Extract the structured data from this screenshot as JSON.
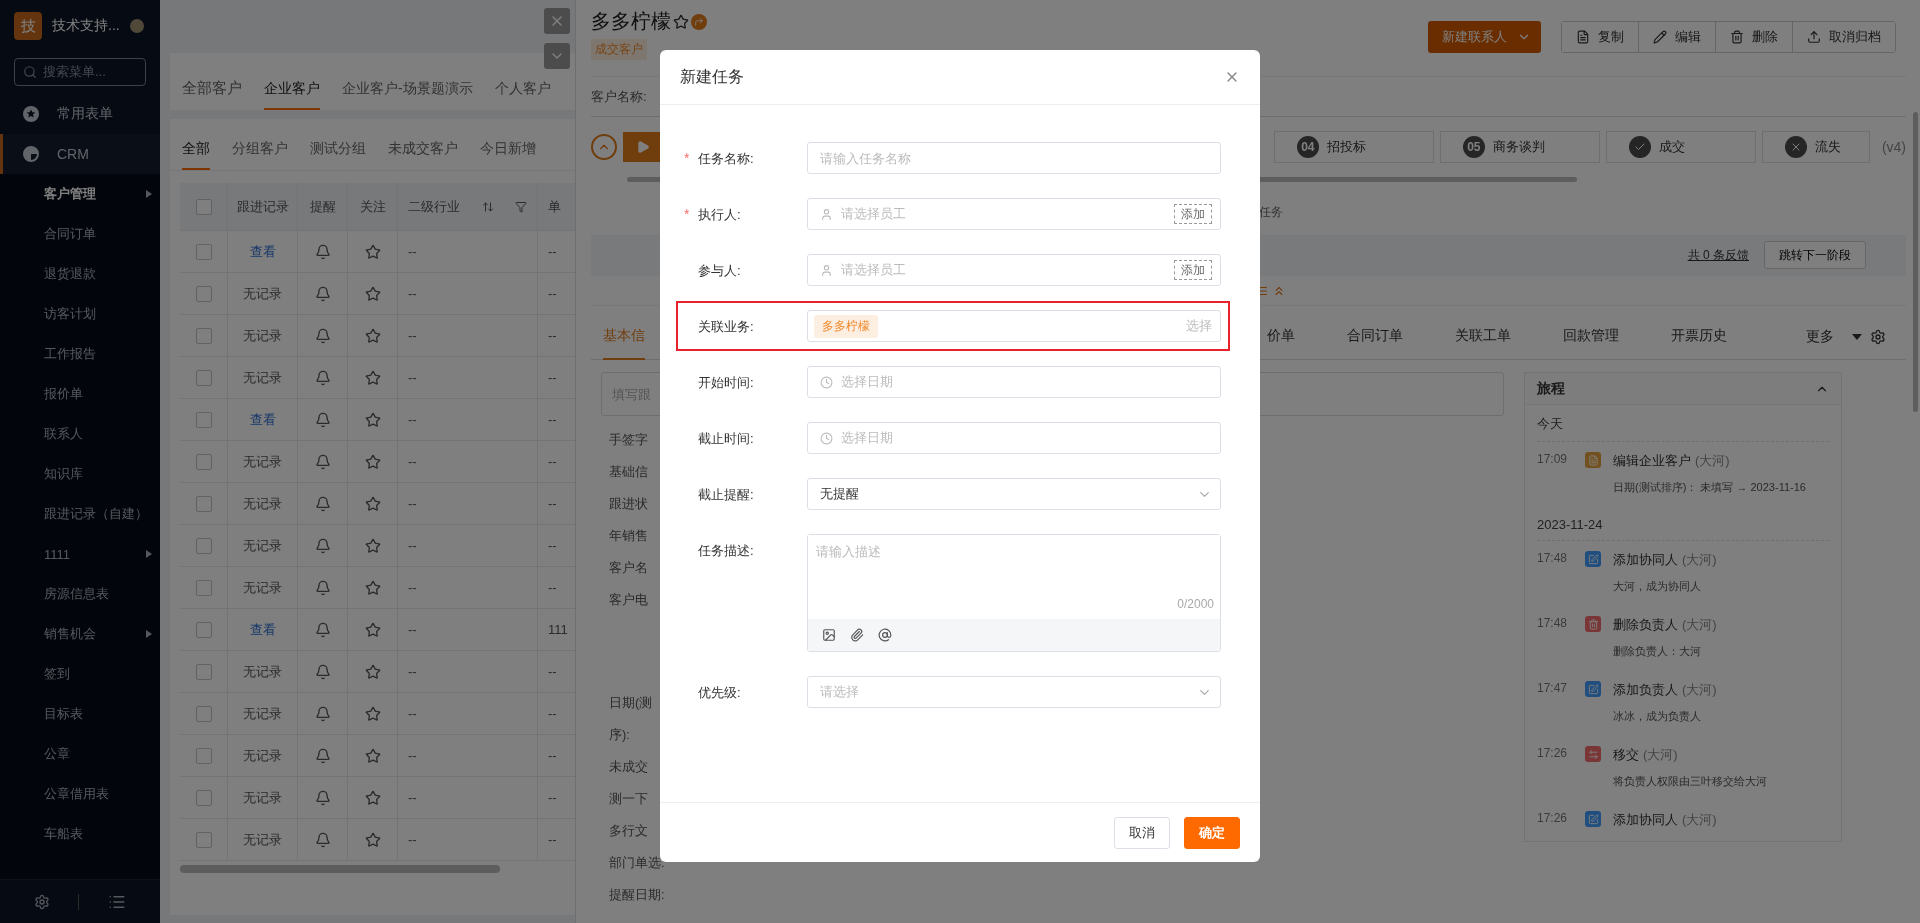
{
  "sidebar": {
    "logo": "技",
    "title": "技术支持...",
    "search_placeholder": "搜索菜单...",
    "sections": [
      {
        "label": "常用表单",
        "kind": "star",
        "selected": false
      },
      {
        "label": "CRM",
        "kind": "chart",
        "selected": true
      }
    ],
    "menu": [
      {
        "label": "客户管理",
        "selected": true,
        "submenu": true
      },
      {
        "label": "合同订单",
        "selected": false,
        "submenu": false
      },
      {
        "label": "退货退款",
        "selected": false,
        "submenu": false
      },
      {
        "label": "访客计划",
        "selected": false,
        "submenu": false
      },
      {
        "label": "工作报告",
        "selected": false,
        "submenu": false
      },
      {
        "label": "报价单",
        "selected": false,
        "submenu": false
      },
      {
        "label": "联系人",
        "selected": false,
        "submenu": false
      },
      {
        "label": "知识库",
        "selected": false,
        "submenu": false
      },
      {
        "label": "跟进记录（自建）",
        "selected": false,
        "submenu": false
      },
      {
        "label": "1111",
        "selected": false,
        "submenu": true
      },
      {
        "label": "房源信息表",
        "selected": false,
        "submenu": false
      },
      {
        "label": "销售机会",
        "selected": false,
        "submenu": true
      },
      {
        "label": "签到",
        "selected": false,
        "submenu": false
      },
      {
        "label": "目标表",
        "selected": false,
        "submenu": false
      },
      {
        "label": "公章",
        "selected": false,
        "submenu": false
      },
      {
        "label": "公章借用表",
        "selected": false,
        "submenu": false
      },
      {
        "label": "车船表",
        "selected": false,
        "submenu": false
      }
    ]
  },
  "customer_tabs": [
    {
      "label": "全部客户",
      "selected": false
    },
    {
      "label": "企业客户",
      "selected": true
    },
    {
      "label": "企业客户-场景题演示",
      "selected": false
    },
    {
      "label": "个人客户",
      "selected": false
    }
  ],
  "group_tabs": [
    {
      "label": "全部",
      "selected": true
    },
    {
      "label": "分组客户",
      "selected": false
    },
    {
      "label": "测试分组",
      "selected": false
    },
    {
      "label": "未成交客户",
      "selected": false
    },
    {
      "label": "今日新增",
      "selected": false
    }
  ],
  "table": {
    "all_checked": false,
    "columns": [
      "跟进记录",
      "提醒",
      "关注",
      "二级行业",
      "单"
    ],
    "rows": [
      {
        "checked": false,
        "record": "查看",
        "kind": "link",
        "followed": false,
        "industry": "--",
        "column_5": "--"
      },
      {
        "checked": false,
        "record": "无记录",
        "kind": "text",
        "followed": false,
        "industry": "--",
        "column_5": "--"
      },
      {
        "checked": false,
        "record": "无记录",
        "kind": "text",
        "followed": false,
        "industry": "--",
        "column_5": "--"
      },
      {
        "checked": false,
        "record": "无记录",
        "kind": "text",
        "followed": false,
        "industry": "--",
        "column_5": "--"
      },
      {
        "checked": false,
        "record": "查看",
        "kind": "link",
        "followed": false,
        "industry": "--",
        "column_5": "--"
      },
      {
        "checked": false,
        "record": "无记录",
        "kind": "text",
        "followed": false,
        "industry": "--",
        "column_5": "--"
      },
      {
        "checked": false,
        "record": "无记录",
        "kind": "text",
        "followed": false,
        "industry": "--",
        "column_5": "--"
      },
      {
        "checked": false,
        "record": "无记录",
        "kind": "text",
        "followed": false,
        "industry": "--",
        "column_5": "--"
      },
      {
        "checked": false,
        "record": "无记录",
        "kind": "text",
        "followed": false,
        "industry": "--",
        "column_5": "--"
      },
      {
        "checked": false,
        "record": "查看",
        "kind": "link",
        "followed": false,
        "industry": "--",
        "column_5": "111"
      },
      {
        "checked": false,
        "record": "无记录",
        "kind": "text",
        "followed": false,
        "industry": "--",
        "column_5": "--"
      },
      {
        "checked": false,
        "record": "无记录",
        "kind": "text",
        "followed": false,
        "industry": "--",
        "column_5": "--"
      },
      {
        "checked": false,
        "record": "无记录",
        "kind": "text",
        "followed": false,
        "industry": "--",
        "column_5": "--"
      },
      {
        "checked": false,
        "record": "无记录",
        "kind": "text",
        "followed": false,
        "industry": "--",
        "column_5": "--"
      },
      {
        "checked": false,
        "record": "无记录",
        "kind": "text",
        "followed": false,
        "industry": "--",
        "column_5": "--"
      }
    ]
  },
  "detail": {
    "title": "多多柠檬",
    "status_tag": "成交客户",
    "followed": false,
    "customer_name_label": "客户名称:",
    "primary_button": "新建联系人",
    "actions": [
      {
        "label": "复制",
        "kind": "copy"
      },
      {
        "label": "编辑",
        "kind": "edit"
      },
      {
        "label": "删除",
        "kind": "delete"
      },
      {
        "label": "取消归档",
        "kind": "unarchive"
      }
    ],
    "stages": [
      {
        "number": "04",
        "label": "招投标",
        "kind": "step"
      },
      {
        "number": "05",
        "label": "商务谈判",
        "kind": "step"
      },
      {
        "label": "成交",
        "kind": "won"
      },
      {
        "label": "流失",
        "kind": "lost"
      }
    ],
    "version": "(v4)",
    "task_note": "任务",
    "feedback_link": "共 0 条反馈",
    "next_stage_button": "跳转下一阶段",
    "tabs": [
      {
        "label": "基本信",
        "selected": true
      },
      {
        "label": "价单",
        "selected": false
      },
      {
        "label": "合同订单",
        "selected": false
      },
      {
        "label": "关联工单",
        "selected": false
      },
      {
        "label": "回款管理",
        "selected": false
      },
      {
        "label": "开票历史",
        "selected": false
      }
    ],
    "more": "更多",
    "follow_placeholder": "填写跟",
    "field_labels": [
      "手签字",
      "基础信",
      "跟进状",
      "年销售",
      "客户名",
      "客户电",
      "日期(测",
      "序):",
      "未成交",
      "测一下",
      "多行文",
      "部门单选:",
      "提醒日期:"
    ],
    "timeline": {
      "title": "旅程",
      "groups": [
        {
          "date": "今天",
          "events": [
            {
              "time": "17:09",
              "title": "编辑企业客户",
              "actor": "(大河)",
              "detail": "日期(测试排序)： 未填写 → 2023-11-16",
              "kind": "update"
            }
          ]
        },
        {
          "date": "2023-11-24",
          "events": [
            {
              "time": "17:48",
              "title": "添加协同人",
              "actor": "(大河)",
              "detail": "大河，成为协同人",
              "kind": "add"
            },
            {
              "time": "17:48",
              "title": "删除负责人",
              "actor": "(大河)",
              "detail": "删除负责人：大河",
              "kind": "remove"
            },
            {
              "time": "17:47",
              "title": "添加负责人",
              "actor": "(大河)",
              "detail": "冰冰，成为负责人",
              "kind": "add"
            },
            {
              "time": "17:26",
              "title": "移交",
              "actor": "(大河)",
              "detail": "将负责人权限由三叶移交给大河",
              "kind": "transfer"
            },
            {
              "time": "17:26",
              "title": "添加协同人",
              "actor": "(大河)",
              "kind": "add"
            }
          ]
        }
      ]
    }
  },
  "modal": {
    "title": "新建任务",
    "fields": [
      {
        "label": "任务名称:",
        "required_mark": "*",
        "kind": "text",
        "placeholder": "请输入任务名称"
      },
      {
        "label": "执行人:",
        "required_mark": "*",
        "kind": "user",
        "placeholder": "请选择员工",
        "action": "添加"
      },
      {
        "label": "参与人:",
        "kind": "user",
        "placeholder": "请选择员工",
        "action": "添加"
      },
      {
        "label": "关联业务:",
        "kind": "business",
        "tag": "多多柠檬",
        "action": "选择",
        "highlighted": true
      },
      {
        "label": "开始时间:",
        "kind": "date",
        "placeholder": "选择日期"
      },
      {
        "label": "截止时间:",
        "kind": "date",
        "placeholder": "选择日期"
      },
      {
        "label": "截止提醒:",
        "kind": "select",
        "value": "无提醒"
      },
      {
        "label": "任务描述:",
        "kind": "textarea",
        "placeholder": "请输入描述",
        "counter": "0/2000"
      },
      {
        "label": "优先级:",
        "kind": "select",
        "placeholder": "请选择"
      }
    ],
    "buttons": [
      {
        "label": "取消",
        "kind": "secondary"
      },
      {
        "label": "确定",
        "kind": "primary"
      }
    ]
  }
}
